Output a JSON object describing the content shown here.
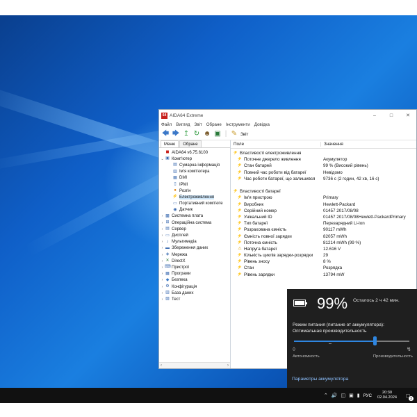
{
  "window": {
    "title": "AIDA64 Extreme",
    "app_icon_text": "64",
    "menu": [
      "Файл",
      "Вигляд",
      "Звіт",
      "Обране",
      "Інструменти",
      "Довідка"
    ],
    "toolbar_report_label": "Звіт",
    "tabs": [
      "Меню",
      "Обране"
    ],
    "tree": [
      {
        "label": "AIDA64 v6.75.6100",
        "icon": "aida-icon",
        "level": 0,
        "exp": ""
      },
      {
        "label": "Комп'ютер",
        "icon": "computer-icon",
        "level": 0,
        "exp": "v"
      },
      {
        "label": "Сумарна інформація",
        "icon": "summary-icon",
        "level": 1,
        "exp": ""
      },
      {
        "label": "Ім'я комп'ютера",
        "icon": "computer-name-icon",
        "level": 1,
        "exp": ""
      },
      {
        "label": "DMI",
        "icon": "dmi-icon",
        "level": 1,
        "exp": ""
      },
      {
        "label": "IPMI",
        "icon": "ipmi-icon",
        "level": 1,
        "exp": ""
      },
      {
        "label": "Розгін",
        "icon": "overclock-icon",
        "level": 1,
        "exp": ""
      },
      {
        "label": "Електроживлення",
        "icon": "power-icon",
        "level": 1,
        "exp": "",
        "selected": true
      },
      {
        "label": "Портативний комп'юте",
        "icon": "portable-icon",
        "level": 1,
        "exp": ""
      },
      {
        "label": "Датчик",
        "icon": "sensor-icon",
        "level": 1,
        "exp": ""
      },
      {
        "label": "Системна плата",
        "icon": "motherboard-icon",
        "level": 0,
        "exp": ">"
      },
      {
        "label": "Операційна система",
        "icon": "os-icon",
        "level": 0,
        "exp": ">"
      },
      {
        "label": "Сервер",
        "icon": "server-icon",
        "level": 0,
        "exp": ">"
      },
      {
        "label": "Дисплей",
        "icon": "display-icon",
        "level": 0,
        "exp": ">"
      },
      {
        "label": "Мультимедіа",
        "icon": "multimedia-icon",
        "level": 0,
        "exp": ">"
      },
      {
        "label": "Збереження даних",
        "icon": "storage-icon",
        "level": 0,
        "exp": ">"
      },
      {
        "label": "Мережа",
        "icon": "network-icon",
        "level": 0,
        "exp": ">"
      },
      {
        "label": "DirectX",
        "icon": "directx-icon",
        "level": 0,
        "exp": ">"
      },
      {
        "label": "Пристрої",
        "icon": "devices-icon",
        "level": 0,
        "exp": ">"
      },
      {
        "label": "Програми",
        "icon": "programs-icon",
        "level": 0,
        "exp": ">"
      },
      {
        "label": "Безпека",
        "icon": "security-icon",
        "level": 0,
        "exp": ">"
      },
      {
        "label": "Конфігурація",
        "icon": "config-icon",
        "level": 0,
        "exp": ">"
      },
      {
        "label": "База даних",
        "icon": "database-icon",
        "level": 0,
        "exp": ">"
      },
      {
        "label": "Тест",
        "icon": "test-icon",
        "level": 0,
        "exp": ">"
      }
    ],
    "columns": {
      "field": "Поле",
      "value": "Значення"
    },
    "rows": [
      {
        "type": "group",
        "field": "Властивості електроживлення",
        "value": ""
      },
      {
        "type": "item",
        "field": "Поточне джерело живлення",
        "value": "Акумулятор"
      },
      {
        "type": "item",
        "field": "Стан батарей",
        "value": "99 % (Високий рівень)"
      },
      {
        "type": "item",
        "field": "Повний час роботи від батареї",
        "value": "Невідомо"
      },
      {
        "type": "item",
        "field": "Час роботи батареї, що залишився",
        "value": "9736 с (2 годин, 42 хв, 16 с)"
      },
      {
        "type": "spacer"
      },
      {
        "type": "group",
        "field": "Властивості батареї",
        "value": ""
      },
      {
        "type": "item",
        "field": "Ім'я пристрою",
        "value": "Primary"
      },
      {
        "type": "item",
        "field": "Виробник",
        "value": "Hewlett-Packard"
      },
      {
        "type": "item",
        "field": "Серійний номер",
        "value": "01457 2017/08/08"
      },
      {
        "type": "item",
        "field": "Унікальний ID",
        "value": "01457 2017/08/08Hewlett-PackardPrimary"
      },
      {
        "type": "item",
        "field": "Тип батареї",
        "value": "Перезарядний Li-Ion"
      },
      {
        "type": "item",
        "field": "Розрахована ємність",
        "value": "90117 mWh"
      },
      {
        "type": "item",
        "field": "Ємність повної зарядки",
        "value": "82057 mWh"
      },
      {
        "type": "item",
        "field": "Поточна ємність",
        "value": "81214 mWh  (99 %)"
      },
      {
        "type": "item",
        "field": "Напруга батареї",
        "value": "12.616 V",
        "warn": true
      },
      {
        "type": "item",
        "field": "Кількість циклів зарядки-розрядки",
        "value": "29"
      },
      {
        "type": "item",
        "field": "Рівень зносу",
        "value": "8 %"
      },
      {
        "type": "item",
        "field": "Стан",
        "value": "Розрядка"
      },
      {
        "type": "item",
        "field": "Рівень зарядки",
        "value": "13794 mW"
      }
    ]
  },
  "battery_flyout": {
    "percent": "99%",
    "charge_fraction": 0.99,
    "remaining": "Осталось 2 ч 42 мин.",
    "mode_title": "Режим питания (питание от аккумулятора): Оптимальная производительность",
    "slider_fraction": 0.7,
    "left_label": "Автономность",
    "right_label": "Производительность",
    "settings_link": "Параметры аккумулятора",
    "accent": "#2f86e0"
  },
  "taskbar": {
    "language": "РУС",
    "time": "20:30",
    "date": "02.04.2024",
    "notification_count": "3"
  }
}
